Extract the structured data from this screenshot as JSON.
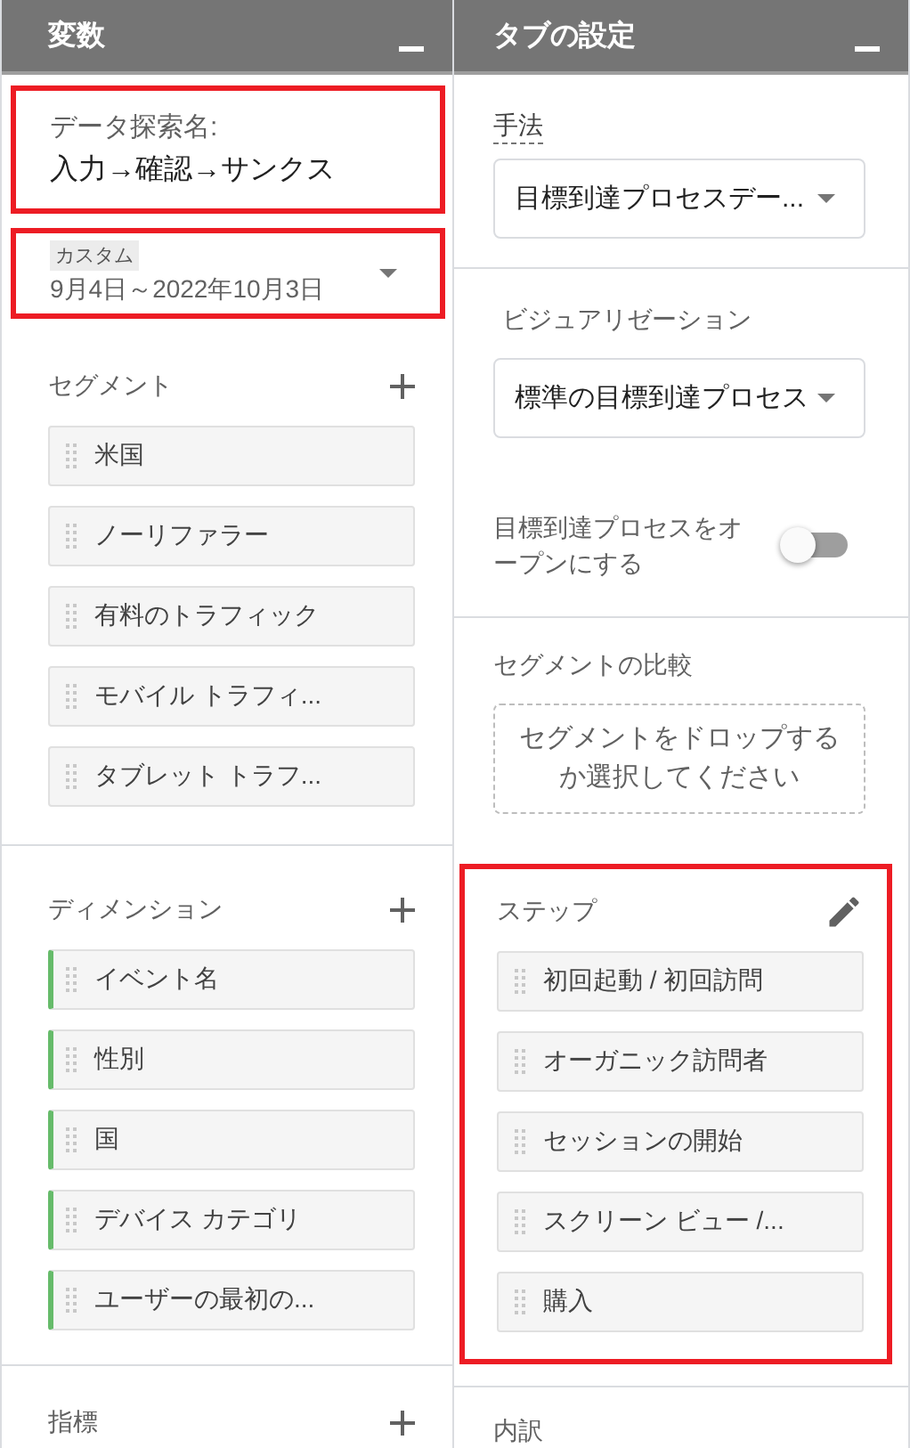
{
  "variables": {
    "title": "変数",
    "exploration_name": {
      "label": "データ探索名:",
      "value": "入力→確認→サンクス",
      "highlighted": true
    },
    "date_range": {
      "badge": "カスタム",
      "value": "9月4日～2022年10月3日",
      "highlighted": true
    },
    "segments": {
      "title": "セグメント",
      "items": [
        "米国",
        "ノーリファラー",
        "有料のトラフィック",
        "モバイル トラフィ...",
        "タブレット トラフ..."
      ]
    },
    "dimensions": {
      "title": "ディメンション",
      "items": [
        "イベント名",
        "性別",
        "国",
        "デバイス カテゴリ",
        "ユーザーの最初の..."
      ]
    },
    "metrics": {
      "title": "指標"
    }
  },
  "tab_settings": {
    "title": "タブの設定",
    "technique": {
      "label": "手法",
      "value": "目標到達プロセスデー..."
    },
    "visualization": {
      "label": "ビジュアリゼーション",
      "value": "標準の目標到達プロセス"
    },
    "open_funnel": {
      "label": "目標到達プロセスをオープンにする",
      "on": false
    },
    "segment_comparison": {
      "title": "セグメントの比較",
      "placeholder": "セグメントをドロップするか選択してください"
    },
    "steps": {
      "title": "ステップ",
      "highlighted": true,
      "items": [
        "初回起動 / 初回訪問",
        "オーガニック訪問者",
        "セッションの開始",
        "スクリーン ビュー /...",
        "購入"
      ]
    },
    "breakdown": {
      "title": "内訳"
    }
  }
}
